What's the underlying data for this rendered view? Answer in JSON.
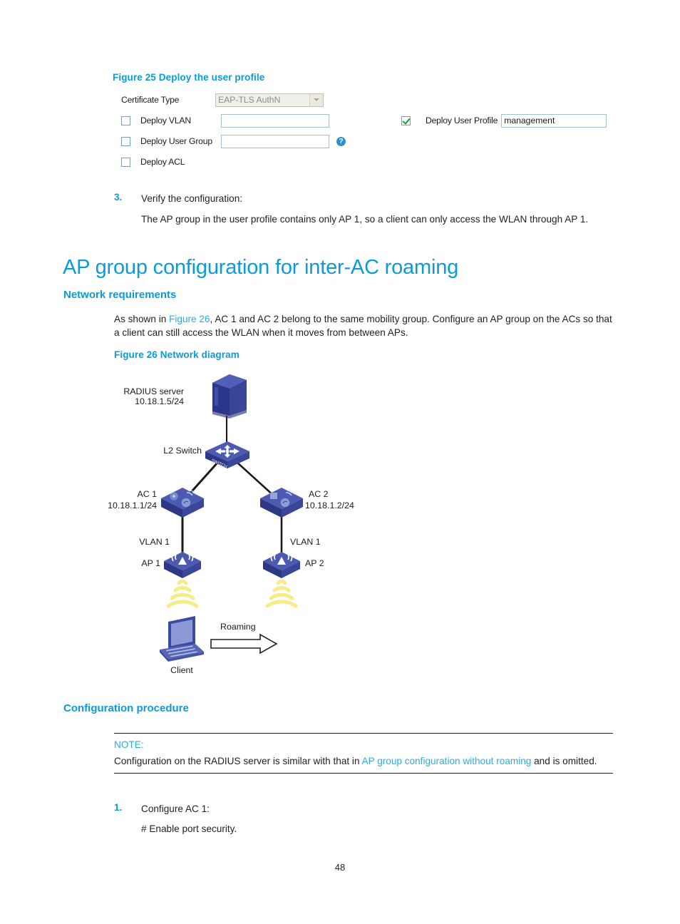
{
  "page": {
    "number": "48"
  },
  "figure25": {
    "caption": "Figure 25 Deploy the user profile",
    "form": {
      "certificate_type_label": "Certificate Type",
      "certificate_type_value": "EAP-TLS AuthN",
      "deploy_vlan_label": "Deploy VLAN",
      "deploy_vlan_value": "",
      "deploy_user_group_label": "Deploy User Group",
      "deploy_user_group_value": "",
      "deploy_acl_label": "Deploy ACL",
      "deploy_user_profile_label": "Deploy User Profile",
      "deploy_user_profile_value": "management",
      "help_icon": "question-mark-icon",
      "checkbox_states": {
        "deploy_vlan": "unchecked",
        "deploy_user_group": "unchecked",
        "deploy_acl": "unchecked",
        "deploy_user_profile": "checked"
      }
    }
  },
  "step3": {
    "number": "3.",
    "title": "Verify the configuration:",
    "body": "The AP group in the user profile contains only AP 1, so a client can only access the WLAN through AP 1."
  },
  "chapter": {
    "title": "AP group configuration for inter-AC roaming"
  },
  "network_requirements": {
    "heading": "Network requirements",
    "text_before_link": "As shown in ",
    "link": "Figure 26",
    "text_after_link": ", AC 1 and AC 2 belong to the same mobility group. Configure an AP group on the ACs so that a client can still access the WLAN when it moves from between APs."
  },
  "figure26": {
    "caption": "Figure 26 Network diagram",
    "nodes": {
      "radius_server_name": "RADIUS server",
      "radius_server_ip": "10.18.1.5/24",
      "switch_label": "L2 Switch",
      "ac1_name": "AC 1",
      "ac1_ip": "10.18.1.1/24",
      "ac2_name": "AC 2",
      "ac2_ip": "10.18.1.2/24",
      "vlan_left": "VLAN 1",
      "vlan_right": "VLAN 1",
      "ap1_name": "AP 1",
      "ap2_name": "AP 2",
      "client_name": "Client",
      "roaming_label": "Roaming"
    }
  },
  "configuration_procedure": {
    "heading": "Configuration procedure",
    "note": {
      "title": "NOTE:",
      "text_before_link": "Configuration on the RADIUS server is similar with that in ",
      "link": "AP group configuration without roaming",
      "text_after_link": " and is omitted."
    },
    "step1": {
      "number": "1.",
      "title": "Configure AC 1:",
      "command": "# Enable port security."
    }
  },
  "colors": {
    "heading_blue": "#0b9bd8",
    "link_blue": "#2aace2",
    "device_blue": "#3b4ba0",
    "device_blue_light": "#5566bb",
    "signal_yellow": "#f7eb8a",
    "text_black": "#231f20"
  }
}
